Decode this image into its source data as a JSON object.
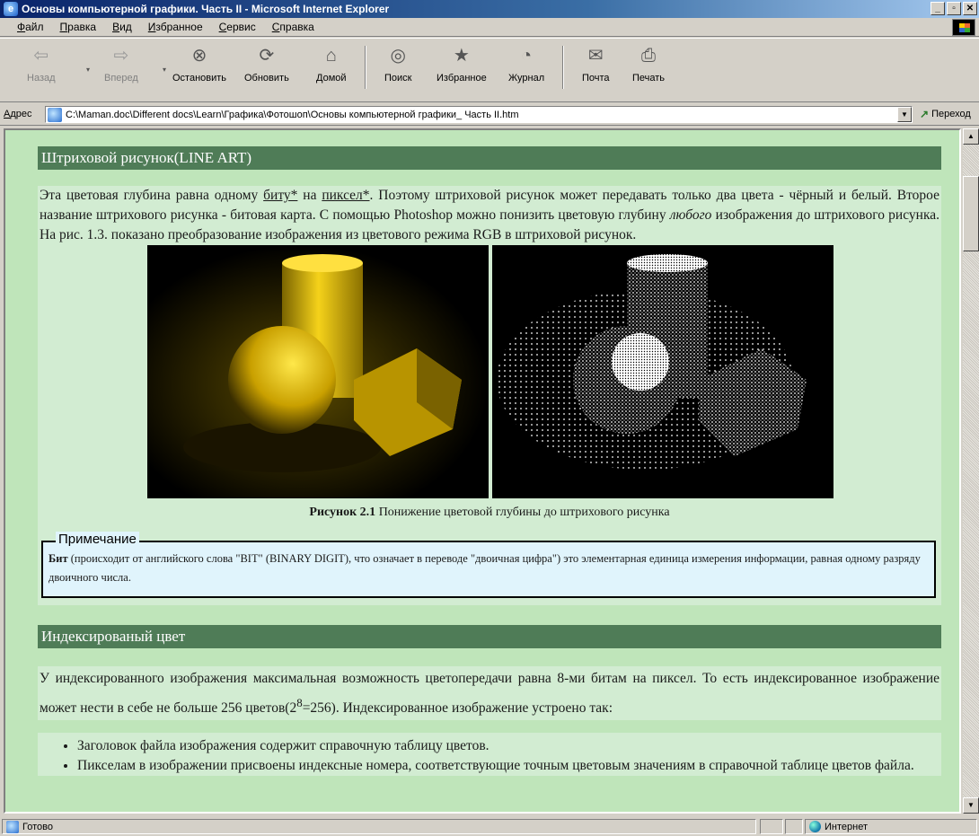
{
  "window": {
    "title": "Основы компьютерной графики. Часть II - Microsoft Internet Explorer",
    "controls": [
      "_",
      "▫",
      "✕"
    ]
  },
  "menu": [
    "Файл",
    "Правка",
    "Вид",
    "Избранное",
    "Сервис",
    "Справка"
  ],
  "toolbar": {
    "back": "Назад",
    "forward": "Вперед",
    "stop": "Остановить",
    "refresh": "Обновить",
    "home": "Домой",
    "search": "Поиск",
    "favorites": "Избранное",
    "history": "Журнал",
    "mail": "Почта",
    "print": "Печать"
  },
  "address": {
    "label": "Адрес",
    "url": "C:\\Maman.doc\\Different docs\\Learn\\Графика\\Фотошоп\\Основы компьютерной графики_ Часть II.htm",
    "go": "Переход"
  },
  "page": {
    "section1_title": "Штриховой рисунок(LINE ART)",
    "p1_a": "Эта цветовая глубина равна одному ",
    "p1_link1": "биту*",
    "p1_b": " на ",
    "p1_link2": "пиксел*",
    "p1_c": ". Поэтому штриховой рисунок может передавать только два цвета - чёрный и белый. Второе название штрихового рисунка - битовая карта. С помощью Photoshop можно понизить цветовую глубину ",
    "p1_em": "любого",
    "p1_d": " изображения до штрихового рисунка. На рис. 1.3. показано преобразование изображения из цветового режима RGB в штриховой рисунок.",
    "caption_bold": "Рисунок 2.1",
    "caption_text": " Понижение цветовой глубины до штрихового рисунка",
    "note_label": "Примечание",
    "note_bold": "Бит",
    "note_text": " (происходит от английского слова \"BIT\" (BINARY DIGIT), что означает в переводе \"двоичная цифра\") это элементарная единица измерения информации, равная одному разряду двоичного числа.",
    "section2_title": "Индексированый цвет",
    "p2_a": "У индексированного изображения максимальная возможность цветопередачи равна 8-ми битам на пиксел. То есть индексированное изображение может нести в себе не больше 256 цветов(2",
    "p2_sup": "8",
    "p2_b": "=256). Индексированное изображение устроено так:",
    "list": [
      "Заголовок файла изображения содержит справочную таблицу цветов.",
      "Пикселам в изображении присвоены индексные номера, соответствующие точным цветовым значениям в справочной таблице цветов файла."
    ]
  },
  "status": {
    "text": "Готово",
    "zone": "Интернет"
  },
  "colors": {
    "section_header": "#4f7c57",
    "page_bg": "#bfe5ba",
    "note_bg": "#e0f4fc"
  }
}
